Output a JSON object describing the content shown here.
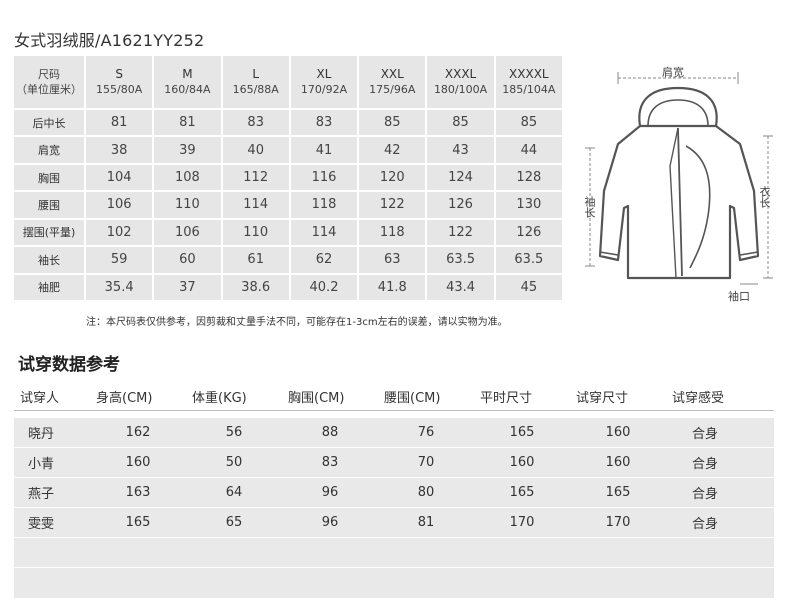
{
  "title": "女式羽绒服/A1621YY252",
  "size_table": {
    "corner_label_1": "尺码",
    "corner_label_2": "（单位厘米）",
    "columns": [
      {
        "size": "S",
        "spec": "155/80A"
      },
      {
        "size": "M",
        "spec": "160/84A"
      },
      {
        "size": "L",
        "spec": "165/88A"
      },
      {
        "size": "XL",
        "spec": "170/92A"
      },
      {
        "size": "XXL",
        "spec": "175/96A"
      },
      {
        "size": "XXXL",
        "spec": "180/100A"
      },
      {
        "size": "XXXXL",
        "spec": "185/104A"
      }
    ],
    "rows": [
      {
        "label": "后中长",
        "values": [
          "81",
          "81",
          "83",
          "83",
          "85",
          "85",
          "85"
        ]
      },
      {
        "label": "肩宽",
        "values": [
          "38",
          "39",
          "40",
          "41",
          "42",
          "43",
          "44"
        ]
      },
      {
        "label": "胸围",
        "values": [
          "104",
          "108",
          "112",
          "116",
          "120",
          "124",
          "128"
        ]
      },
      {
        "label": "腰围",
        "values": [
          "106",
          "110",
          "114",
          "118",
          "122",
          "126",
          "130"
        ]
      },
      {
        "label": "摆围(平量)",
        "values": [
          "102",
          "106",
          "110",
          "114",
          "118",
          "122",
          "126"
        ]
      },
      {
        "label": "袖长",
        "values": [
          "59",
          "60",
          "61",
          "62",
          "63",
          "63.5",
          "63.5"
        ]
      },
      {
        "label": "袖肥",
        "values": [
          "35.4",
          "37",
          "38.6",
          "40.2",
          "41.8",
          "43.4",
          "45"
        ]
      }
    ]
  },
  "note": "注：本尺码表仅供参考，因剪裁和丈量手法不同，可能存在1-3cm左右的误差，请以实物为准。",
  "diagram": {
    "shoulder_label": "肩宽",
    "sleeve_label": "袖长",
    "length_label": "衣长",
    "cuff_label": "袖口"
  },
  "tryon": {
    "section_title": "试穿数据参考",
    "headers": [
      "试穿人",
      "身高(CM)",
      "体重(KG)",
      "胸围(CM)",
      "腰围(CM)",
      "平时尺寸",
      "试穿尺寸",
      "试穿感受"
    ],
    "rows": [
      [
        "晓丹",
        "162",
        "56",
        "88",
        "76",
        "165",
        "160",
        "合身"
      ],
      [
        "小青",
        "160",
        "50",
        "83",
        "70",
        "160",
        "160",
        "合身"
      ],
      [
        "燕子",
        "163",
        "64",
        "96",
        "80",
        "165",
        "165",
        "合身"
      ],
      [
        "雯雯",
        "165",
        "65",
        "96",
        "81",
        "170",
        "170",
        "合身"
      ]
    ]
  }
}
